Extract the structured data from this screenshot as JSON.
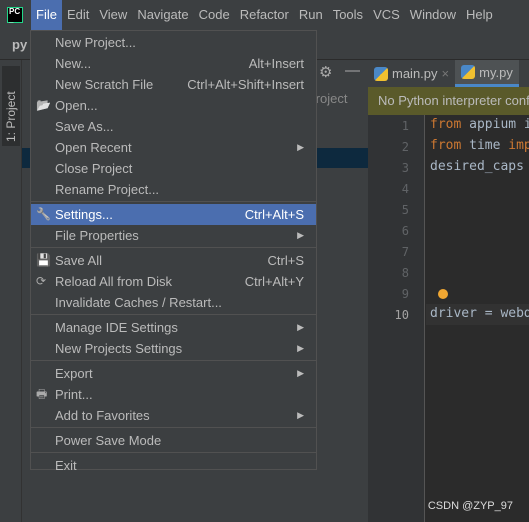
{
  "menubar": {
    "items": [
      "File",
      "Edit",
      "View",
      "Navigate",
      "Code",
      "Refactor",
      "Run",
      "Tools",
      "VCS",
      "Window",
      "Help"
    ],
    "active": "File"
  },
  "project_label": "py",
  "toolwindow": {
    "tab": "1: Project",
    "header_partial": "Project"
  },
  "editor": {
    "tabs": [
      {
        "label": "main.py",
        "closable": true
      },
      {
        "label": "my.py",
        "active": true
      }
    ],
    "banner": "No Python interpreter configured",
    "lines": [
      "1",
      "2",
      "3",
      "4",
      "5",
      "6",
      "7",
      "8",
      "9",
      "10"
    ],
    "code": [
      {
        "kw": "from",
        "rest": " appium i"
      },
      {
        "kw": "from",
        "rest": " time ",
        "kw2": "imp"
      },
      {
        "rest": "desired_caps"
      },
      {
        "rest": "driver = webd"
      }
    ]
  },
  "file_menu": {
    "groups": [
      [
        {
          "label": "New Project..."
        },
        {
          "label": "New...",
          "shortcut": "Alt+Insert"
        },
        {
          "label": "New Scratch File",
          "shortcut": "Ctrl+Alt+Shift+Insert"
        },
        {
          "label": "Open...",
          "icon": "folder-open-icon"
        },
        {
          "label": "Save As..."
        },
        {
          "label": "Open Recent",
          "submenu": true
        },
        {
          "label": "Close Project"
        },
        {
          "label": "Rename Project..."
        }
      ],
      [
        {
          "label": "Settings...",
          "shortcut": "Ctrl+Alt+S",
          "icon": "wrench-icon",
          "highlighted": true
        },
        {
          "label": "File Properties",
          "submenu": true
        }
      ],
      [
        {
          "label": "Save All",
          "shortcut": "Ctrl+S",
          "icon": "save-icon"
        },
        {
          "label": "Reload All from Disk",
          "shortcut": "Ctrl+Alt+Y",
          "icon": "reload-icon"
        },
        {
          "label": "Invalidate Caches / Restart..."
        }
      ],
      [
        {
          "label": "Manage IDE Settings",
          "submenu": true
        },
        {
          "label": "New Projects Settings",
          "submenu": true
        }
      ],
      [
        {
          "label": "Export",
          "submenu": true
        },
        {
          "label": "Print...",
          "icon": "print-icon"
        },
        {
          "label": "Add to Favorites",
          "submenu": true
        }
      ],
      [
        {
          "label": "Power Save Mode"
        }
      ],
      [
        {
          "label": "Exit"
        }
      ]
    ]
  },
  "watermark": "CSDN @ZYP_97",
  "colors": {
    "accent": "#4b6eaf",
    "banner": "#5a5a2a",
    "keyword": "#cc7832"
  }
}
